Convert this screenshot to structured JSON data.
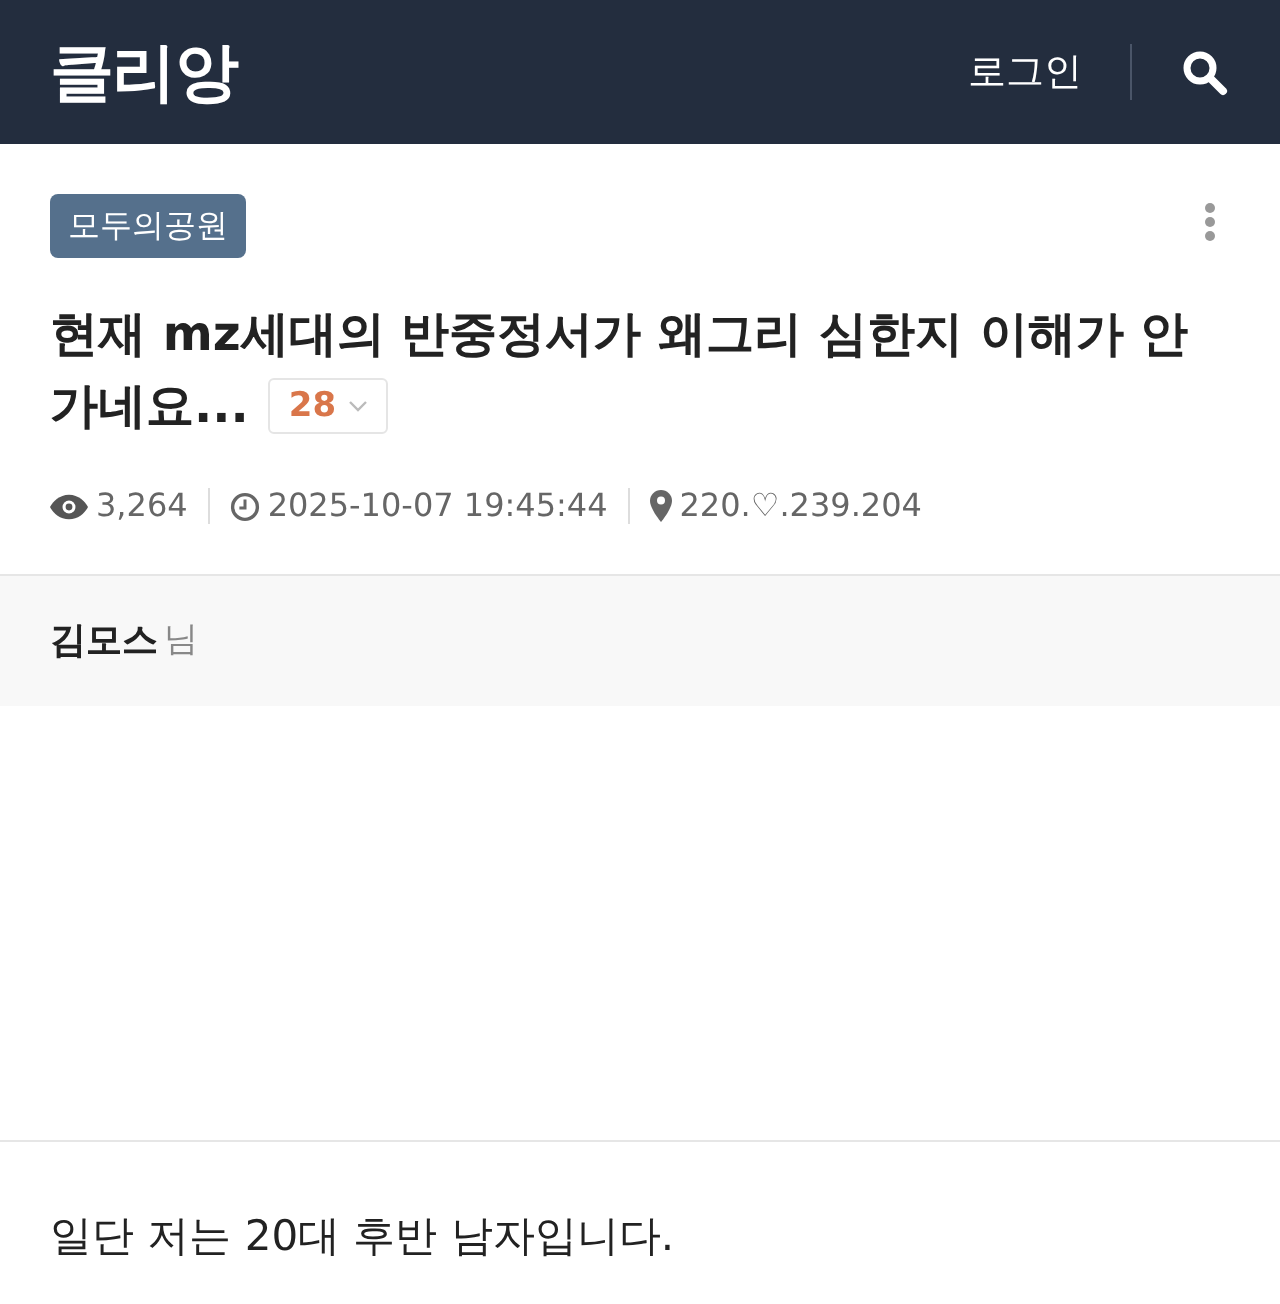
{
  "header": {
    "logo": "클리앙",
    "login": "로그인"
  },
  "post": {
    "board": "모두의공원",
    "title_lines": [
      "현재 mz세대의 반중정서가 왜그리 심한지 이해가 안",
      "가네요..."
    ],
    "comment_count": "28",
    "views": "3,264",
    "date": "2025-10-07 19:45:44",
    "ip": "220.♡.239.204"
  },
  "author": {
    "name": "김모스",
    "suffix": "님"
  },
  "body": "일단 저는 20대 후반 남자입니다."
}
